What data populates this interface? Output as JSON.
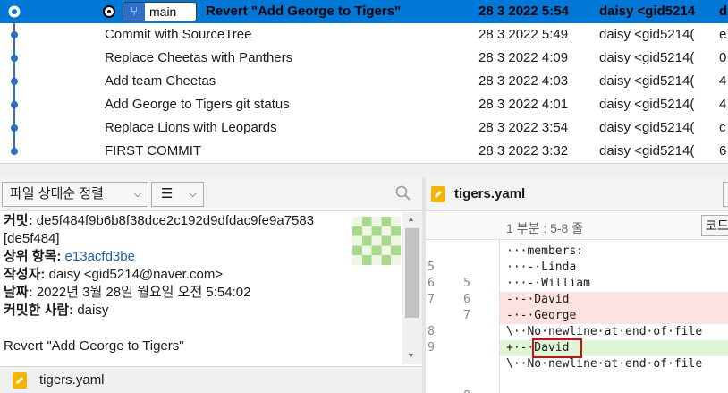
{
  "commits": [
    {
      "subject": "Revert \"Add George to Tigers\"",
      "date": "28 3 2022 5:54",
      "author": "daisy <gid5214",
      "hash": "d",
      "selected": true,
      "branch": "main"
    },
    {
      "subject": "Commit with SourceTree",
      "date": "28 3 2022 5:49",
      "author": "daisy <gid5214(",
      "hash": "e",
      "selected": false
    },
    {
      "subject": "Replace Cheetas with Panthers",
      "date": "28 3 2022 4:09",
      "author": "daisy <gid5214(",
      "hash": "0",
      "selected": false
    },
    {
      "subject": "Add team Cheetas",
      "date": "28 3 2022 4:03",
      "author": "daisy <gid5214(",
      "hash": "4",
      "selected": false
    },
    {
      "subject": "Add George to Tigers git status",
      "date": "28 3 2022 4:01",
      "author": "daisy <gid5214(",
      "hash": "4",
      "selected": false
    },
    {
      "subject": "Replace Lions with Leopards",
      "date": "28 3 2022 3:54",
      "author": "daisy <gid5214(",
      "hash": "c",
      "selected": false
    },
    {
      "subject": "FIRST COMMIT",
      "date": "28 3 2022 3:32",
      "author": "daisy <gid5214(",
      "hash": "6",
      "selected": false
    }
  ],
  "toolbar": {
    "sort_label": "파일 상태순 정렬",
    "view_label": "☰",
    "search_icon": "search-icon"
  },
  "details": {
    "commit_label": "커밋:",
    "commit_value": "de5f484f9b6b8f38dce2c192d9dfdac9fe9a7583",
    "short_hash": "[de5f484]",
    "parent_label": "상위 항목:",
    "parent_value": "e13acfd3be",
    "author_label": "작성자:",
    "author_value": "daisy <gid5214@naver.com>",
    "date_label": "날짜:",
    "date_value": "2022년 3월 28일 월요일 오전 5:54:02",
    "committer_label": "커밋한 사람:",
    "committer_value": "daisy",
    "message": "Revert \"Add George to Tigers\""
  },
  "file_list": {
    "file_name": "tigers.yaml"
  },
  "diff": {
    "file_name": "tigers.yaml",
    "hunk_label": "1 부분 : 5-8 줄",
    "hunk_button": "코드",
    "lines": [
      {
        "old": "5",
        "new": "5",
        "kind": "context",
        "text": "···members:"
      },
      {
        "old": "6",
        "new": "6",
        "kind": "context",
        "text": "···-·Linda"
      },
      {
        "old": "7",
        "new": "7",
        "kind": "context",
        "text": "···-·William"
      },
      {
        "old": "8",
        "new": "",
        "kind": "removed",
        "text": "-·-·David"
      },
      {
        "old": "9",
        "new": "",
        "kind": "removed",
        "text": "-·-·George"
      },
      {
        "old": "",
        "new": "",
        "kind": "context",
        "text": "\\··No·newline·at·end·of·file"
      },
      {
        "old": "",
        "new": "8",
        "kind": "added",
        "text": "+·-·David"
      },
      {
        "old": "",
        "new": "",
        "kind": "context",
        "text": "\\··No·newline·at·end·of·file"
      }
    ]
  },
  "colors": {
    "selection": "#0078d7",
    "graph": "#2f6fc9",
    "removed_bg": "#fde2e2",
    "added_bg": "#dff5d6",
    "highlight": "#d01010"
  }
}
